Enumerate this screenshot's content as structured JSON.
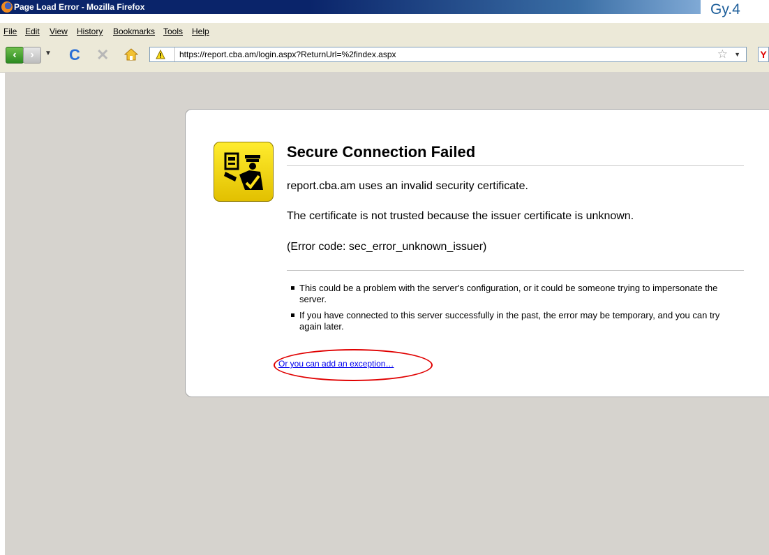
{
  "window": {
    "title": "Page Load Error - Mozilla Firefox",
    "figure_label": "Gy.4"
  },
  "menu": [
    "File",
    "Edit",
    "View",
    "History",
    "Bookmarks",
    "Tools",
    "Help"
  ],
  "navbar": {
    "url": "https://report.cba.am/login.aspx?ReturnUrl=%2findex.aspx",
    "search_engine_glyph": "Y"
  },
  "error": {
    "title": "Secure Connection Failed",
    "short_desc": "report.cba.am uses an invalid security certificate.",
    "detail_1": "The certificate is not trusted because the issuer certificate is unknown.",
    "detail_2": "(Error code: sec_error_unknown_issuer)",
    "bullets": [
      "This could be a problem with the server's configuration, or it could be someone trying to impersonate the server.",
      "If you have connected to this server successfully in the past, the error may be temporary, and you can try again later."
    ],
    "exception_link": "Or you can add an exception…"
  },
  "icons": {
    "browser": "firefox-icon",
    "back": "back-arrow-icon",
    "forward": "forward-arrow-icon",
    "reload": "reload-icon",
    "stop": "stop-icon",
    "home": "home-icon",
    "warning": "warning-triangle-icon",
    "bookmark": "star-icon",
    "error": "officer-passport-icon"
  },
  "colors": {
    "titlebar": "#0a246a",
    "chrome": "#ece9d8",
    "page_background": "#d6d3ce",
    "link": "#0000ee",
    "annotation": "#e00000",
    "warning_yellow": "#ffe21a"
  }
}
